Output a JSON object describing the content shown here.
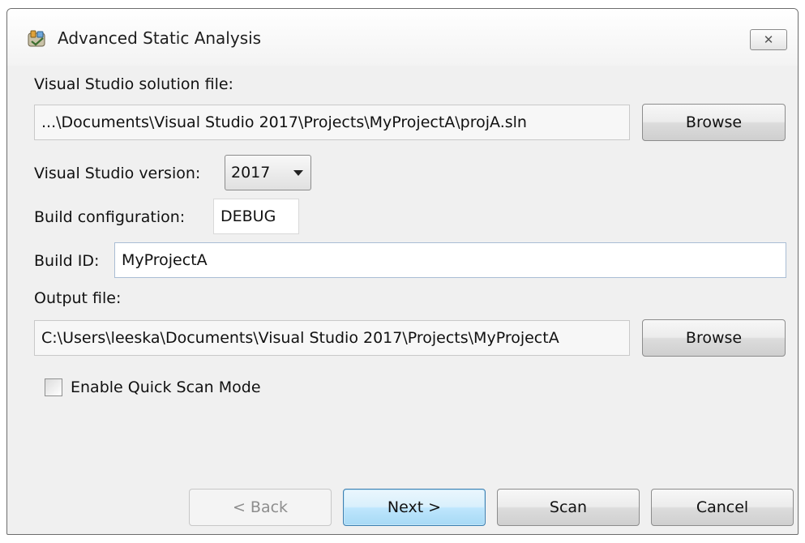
{
  "window": {
    "title": "Advanced Static Analysis",
    "close_symbol": "✕",
    "icon": "app-tools-icon"
  },
  "solution": {
    "label": "Visual Studio solution file:",
    "value": "...\\Documents\\Visual Studio 2017\\Projects\\MyProjectA\\projA.sln",
    "browse_label": "Browse"
  },
  "version": {
    "label": "Visual Studio version:",
    "selected": "2017"
  },
  "build_config": {
    "label": "Build configuration:",
    "value": "DEBUG"
  },
  "build_id": {
    "label": "Build ID:",
    "value": "MyProjectA"
  },
  "output": {
    "label": "Output file:",
    "value": "C:\\Users\\leeska\\Documents\\Visual Studio 2017\\Projects\\MyProjectA",
    "browse_label": "Browse"
  },
  "quick_scan": {
    "label": "Enable Quick Scan Mode",
    "checked": false
  },
  "buttons": {
    "back": "< Back",
    "next": "Next >",
    "scan": "Scan",
    "cancel": "Cancel"
  }
}
